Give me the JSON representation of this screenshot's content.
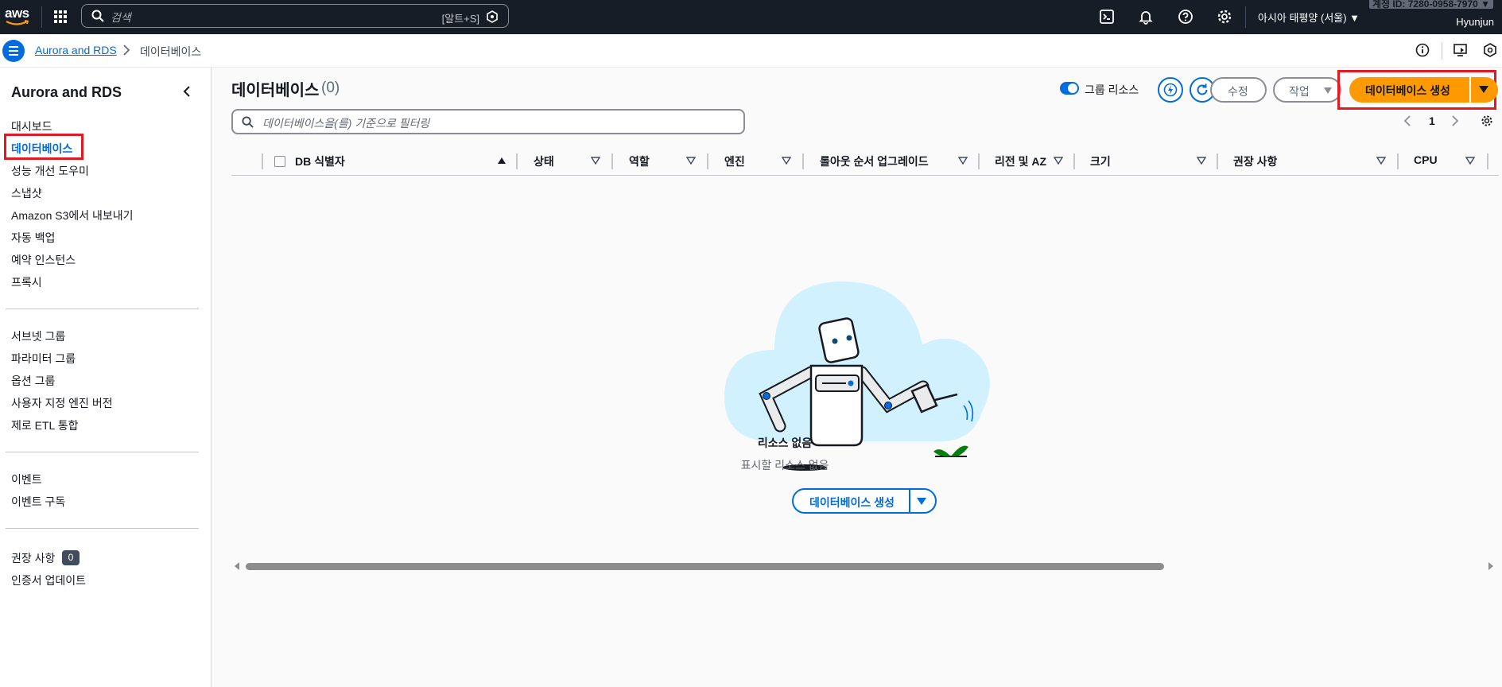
{
  "topnav": {
    "logo_text": "aws",
    "search_placeholder": "검색",
    "search_hotkey": "[알트+S]",
    "region": "아시아 태평양 (서울) ▼",
    "account_id": "계정 ID: 7280-0958-7970 ▼",
    "user": "Hyunjun",
    "icons": [
      "apps-icon",
      "cloudshell-icon",
      "bell-icon",
      "help-icon",
      "gear-icon"
    ]
  },
  "breadcrumb": {
    "link": "Aurora and RDS",
    "current": "데이터베이스",
    "icons": [
      "info-icon",
      "screen-icon",
      "gear-icon"
    ]
  },
  "sidebar": {
    "title": "Aurora and RDS",
    "group1": [
      "대시보드",
      "데이터베이스",
      "성능 개선 도우미",
      "스냅샷",
      "Amazon S3에서 내보내기",
      "자동 백업",
      "예약 인스턴스",
      "프록시"
    ],
    "group2": [
      "서브넷 그룹",
      "파라미터 그룹",
      "옵션 그룹",
      "사용자 지정 엔진 버전",
      "제로 ETL 통합"
    ],
    "group3": [
      "이벤트",
      "이벤트 구독"
    ],
    "group4": [
      "권장 사항",
      "인증서 업데이트"
    ],
    "active_item": "데이터베이스",
    "recommend_badge": "0"
  },
  "main": {
    "title": "데이터베이스",
    "count": "(0)",
    "group_toggle_label": "그룹 리소스",
    "group_toggle_on": true,
    "edit_button": "수정",
    "actions_button": "작업",
    "create_button": "데이터베이스 생성",
    "filter_placeholder": "데이터베이스을(를) 기준으로 필터링",
    "page": "1",
    "columns": [
      "DB 식별자",
      "상태",
      "역할",
      "엔진",
      "롤아웃 순서 업그레이드",
      "리전 및 AZ",
      "크기",
      "권장 사항",
      "CPU"
    ],
    "empty_title": "리소스 없음",
    "empty_subtitle": "표시할 리소스 없음",
    "empty_create_button": "데이터베이스 생성"
  },
  "colors": {
    "nav_bg": "#161d26",
    "accent_blue": "#006ce0",
    "primary_orange": "#ff9900",
    "highlight_red": "#e21a23"
  }
}
